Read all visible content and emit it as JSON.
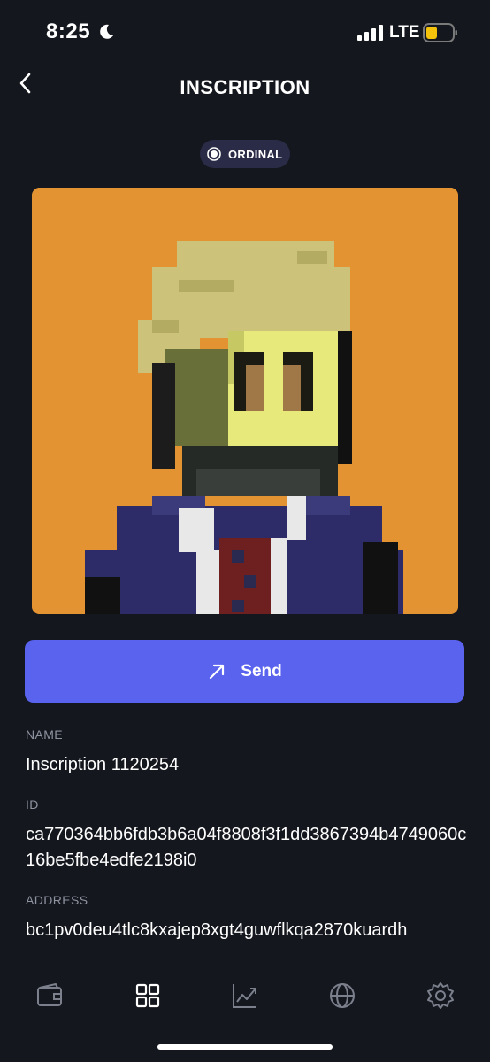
{
  "status_bar": {
    "time": "8:25",
    "network": "LTE",
    "icons": [
      "moon-icon",
      "signal-icon",
      "battery-icon"
    ],
    "battery_color": "#f5c20b"
  },
  "header": {
    "title": "INSCRIPTION",
    "back_icon": "chevron-left-icon"
  },
  "badge": {
    "label": "ORDINAL",
    "icon": "radio-dot-icon"
  },
  "artwork": {
    "subject": "pixel-art-punk",
    "background_color": "#e39331"
  },
  "send_button": {
    "label": "Send",
    "icon": "arrow-up-right-icon",
    "color": "#5a63ee"
  },
  "details": {
    "name_label": "NAME",
    "name_value": "Inscription 1120254",
    "id_label": "ID",
    "id_value": "ca770364bb6fdb3b6a04f8808f3f1dd3867394b4749060c16be5fbe4edfe2198i0",
    "address_label": "ADDRESS",
    "address_value": "bc1pv0deu4tlc8kxajep8xgt4guwflkqa2870kuardh"
  },
  "bottom_nav": {
    "items": [
      "wallet-icon",
      "collectibles-grid-icon",
      "chart-icon",
      "globe-icon",
      "settings-gear-icon"
    ],
    "active_index": 1
  }
}
